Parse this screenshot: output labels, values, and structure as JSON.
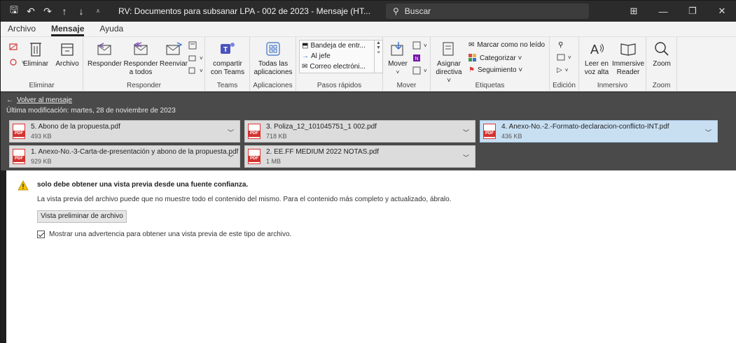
{
  "window": {
    "title": "RV: Documentos para subsanar LPA - 002 de 2023  -  Mensaje (HT...",
    "search_placeholder": "Buscar"
  },
  "tabs": [
    {
      "label": "Archivo"
    },
    {
      "label": "Mensaje",
      "active": true
    },
    {
      "label": "Ayuda"
    }
  ],
  "ribbon": {
    "groups": {
      "eliminar": "Eliminar",
      "responder": "Responder",
      "teams": "Teams",
      "aplicaciones": "Aplicaciones",
      "pasos_rapidos": "Pasos rápidos",
      "mover": "Mover",
      "etiquetas": "Etiquetas",
      "edicion": "Edición",
      "inmersivo": "Inmersivo",
      "zoom": "Zoom"
    },
    "buttons": {
      "eliminar": "Eliminar",
      "archivo": "Archivo",
      "responder": "Responder",
      "responder_todos_1": "Responder",
      "responder_todos_2": "a todos",
      "reenviar": "Reenviar",
      "compartir_1": "compartir",
      "compartir_2": "con Teams",
      "todas_1": "Todas las",
      "todas_2": "aplicaciones",
      "mover": "Mover",
      "asignar_1": "Asignar",
      "asignar_2": "directiva ˅",
      "leer_1": "Leer en",
      "leer_2": "voz alta",
      "immersive_1": "Immersive",
      "immersive_2": "Reader",
      "zoom": "Zoom"
    },
    "quick_steps": [
      "Bandeja de entr...",
      "Al jefe",
      "Correo electróni..."
    ],
    "tags": {
      "marcar": "Marcar como no leído",
      "categorizar": "Categorizar ˅",
      "seguimiento": "Seguimiento ˅"
    }
  },
  "message": {
    "back_label": "Volver al mensaje",
    "modified": "Última modificación:  martes, 28 de noviembre de 2023"
  },
  "attachments": [
    {
      "name": "5. Abono de la propuesta.pdf",
      "size": "493 KB"
    },
    {
      "name": "3. Poliza_12_101045751_1 002.pdf",
      "size": "718 KB"
    },
    {
      "name": "4. Anexo-No.-2.-Formato-declaracion-conflicto-INT.pdf",
      "size": "436 KB",
      "selected": true
    },
    {
      "name": "1. Anexo-No.-3-Carta-de-presentación y abono de la propuesta.pdf",
      "size": "929 KB"
    },
    {
      "name": "2. EE.FF MEDIUM 2022 NOTAS.pdf",
      "size": "1 MB"
    }
  ],
  "preview": {
    "warning_title": "solo debe obtener una vista previa desde una fuente confianza.",
    "warning_text": "La vista previa del archivo puede que no muestre todo el contenido del mismo. Para el contenido más completo y actualizado, ábralo.",
    "button_label": "Vista preliminar de archivo",
    "checkbox_label": "Mostrar una advertencia para obtener una vista previa de este tipo de archivo.",
    "checkbox_checked": true
  },
  "pdf_badge": "PDF"
}
